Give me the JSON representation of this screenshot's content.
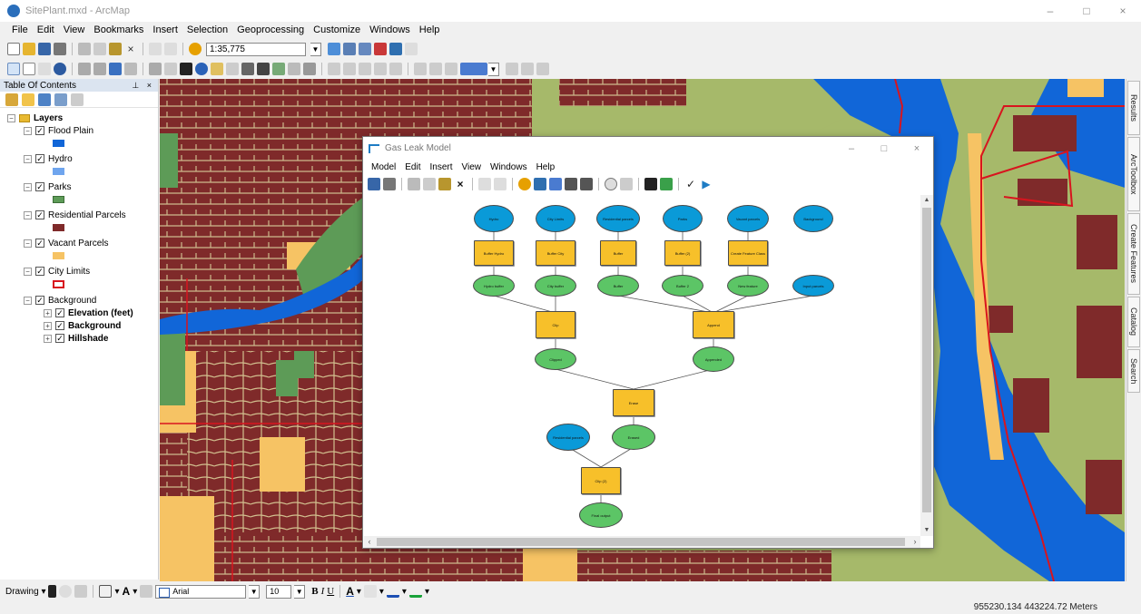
{
  "window": {
    "title": "SitePlant.mxd - ArcMap",
    "minimize": "–",
    "maximize": "□",
    "close": "×"
  },
  "menu": [
    "File",
    "Edit",
    "View",
    "Bookmarks",
    "Insert",
    "Selection",
    "Geoprocessing",
    "Customize",
    "Windows",
    "Help"
  ],
  "toolbar": {
    "scale": "1:35,775"
  },
  "toc": {
    "title": "Table Of Contents",
    "pin": "⊥ ×",
    "root": "Layers",
    "layers": [
      {
        "name": "Flood Plain",
        "color": "#1166d8"
      },
      {
        "name": "Hydro",
        "color": "#6fa5ee"
      },
      {
        "name": "Parks",
        "color": "#5d9b57"
      },
      {
        "name": "Residential Parcels",
        "color": "#7f2a2a"
      },
      {
        "name": "Vacant Parcels",
        "color": "#f6c364"
      },
      {
        "name": "City Limits",
        "color": "#d8141e"
      }
    ],
    "group": "Background",
    "sublayers": [
      "Elevation (feet)",
      "Background",
      "Hillshade"
    ]
  },
  "model_window": {
    "title": "Gas Leak Model",
    "menu": [
      "Model",
      "Edit",
      "Insert",
      "View",
      "Windows",
      "Help"
    ],
    "colors": {
      "input": "#0a9ad8",
      "tool": "#f7c02a",
      "output": "#5cc566"
    },
    "input_labels": [
      "Hydro",
      "City Limits",
      "Residential parcels",
      "Parks",
      "Vacant parcels",
      "Background"
    ],
    "tool_labels": [
      "Buffer Hydro",
      "Buffer City",
      "Buffer",
      "Buffer (2)",
      "Create Feature Class",
      "Clip",
      "Append",
      "Erase",
      "Clip (2)"
    ],
    "output_labels": [
      "Hydro buffer",
      "City buffer",
      "Buffer",
      "Buffer 2",
      "New feature",
      "Clipped",
      "Appended",
      "Erased",
      "Final output"
    ],
    "clip_input": "Residential parcels",
    "clip_input_2": "Input parcels"
  },
  "right_dock": [
    "Results",
    "ArcToolbox",
    "Create Features",
    "Catalog",
    "Search"
  ],
  "drawing": {
    "label": "Drawing ▾",
    "font": "Arial",
    "size": "10"
  },
  "status": {
    "coords": "955230.134  443224.72 Meters"
  }
}
